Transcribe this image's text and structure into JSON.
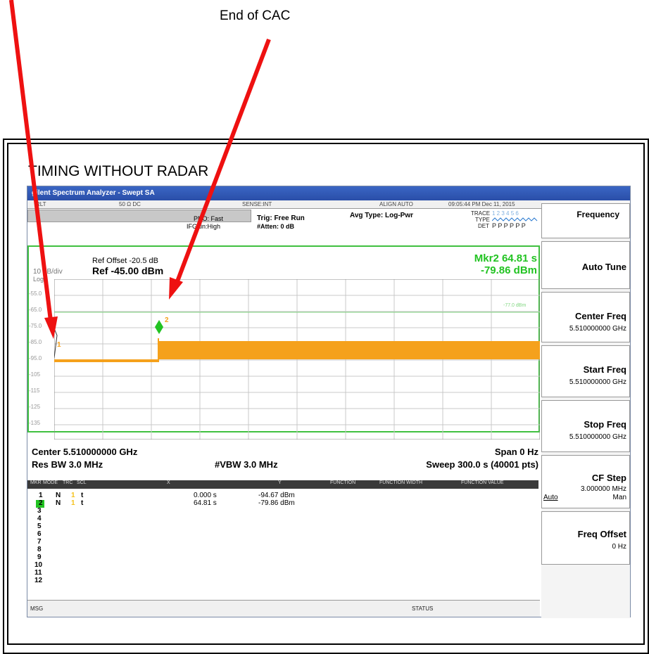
{
  "annotation": {
    "label": "End of CAC"
  },
  "panel": {
    "heading": "TIMING WITHOUT RADAR"
  },
  "window": {
    "title": "gilent Spectrum Analyzer - Swept SA"
  },
  "status_row": {
    "rlt": "RLT",
    "coupling": "50 Ω  DC",
    "sense": "SENSE:INT",
    "align": "ALIGN AUTO",
    "datetime": "09:05:44 PM Dec 11, 2015"
  },
  "settings": {
    "avg_type": "Avg Type: Log-Pwr",
    "trace_label": "TRACE",
    "trace_values": "1 2 3 4 5 6",
    "type_label": "TYPE",
    "det_label": "DET",
    "det_values": "P P P P P P",
    "pno": "PNO: Fast",
    "ifgain": "IFGain:High",
    "trig": "Trig: Free Run",
    "atten": "#Atten: 0 dB"
  },
  "display": {
    "ref_offset": "Ref Offset -20.5 dB",
    "scale": "10 dB/div",
    "log": "Log",
    "ref_level": "Ref -45.00 dBm",
    "marker_readout_x": "Mkr2 64.81 s",
    "marker_readout_y": "-79.86 dBm",
    "y_ticks": [
      "-55.0",
      "-65.0",
      "-75.0",
      "-85.0",
      "-95.0",
      "-105",
      "-115",
      "-125",
      "-135"
    ],
    "threshold_label": "-77.0 dBm",
    "marker2_label": "2",
    "marker1_label": "1"
  },
  "footer": {
    "center": "Center 5.510000000 GHz",
    "res_bw": "Res BW 3.0 MHz",
    "vbw": "#VBW 3.0 MHz",
    "span": "Span 0 Hz",
    "sweep": "Sweep  300.0 s (40001 pts)"
  },
  "marker_table": {
    "headers": [
      "MKR",
      "MODE",
      "TRC",
      "SCL",
      "X",
      "Y",
      "FUNCTION",
      "FUNCTION WIDTH",
      "FUNCTION VALUE"
    ],
    "rows": [
      {
        "num": "1",
        "mode": "N",
        "trc": "1",
        "scl": "t",
        "x": "0.000 s",
        "y": "-94.67 dBm"
      },
      {
        "num": "2",
        "mode": "N",
        "trc": "1",
        "scl": "t",
        "x": "64.81 s",
        "y": "-79.86 dBm"
      }
    ],
    "empty_rows": [
      "3",
      "4",
      "5",
      "6",
      "7",
      "8",
      "9",
      "10",
      "11",
      "12"
    ]
  },
  "msg_bar": {
    "msg": "MSG",
    "status": "STATUS"
  },
  "softkeys": {
    "menu": "Frequency",
    "auto_tune": "Auto Tune",
    "center_freq": "Center Freq",
    "center_freq_val": "5.510000000 GHz",
    "start_freq": "Start Freq",
    "start_freq_val": "5.510000000 GHz",
    "stop_freq": "Stop Freq",
    "stop_freq_val": "5.510000000 GHz",
    "cf_step": "CF Step",
    "cf_step_val": "3.000000 MHz",
    "cf_auto": "Auto",
    "cf_man": "Man",
    "freq_offset": "Freq Offset",
    "freq_offset_val": "0 Hz"
  },
  "colors": {
    "trace": "#f5a11c",
    "marker": "#22c322",
    "arrow": "#ee1111",
    "frame": "#40c040"
  }
}
